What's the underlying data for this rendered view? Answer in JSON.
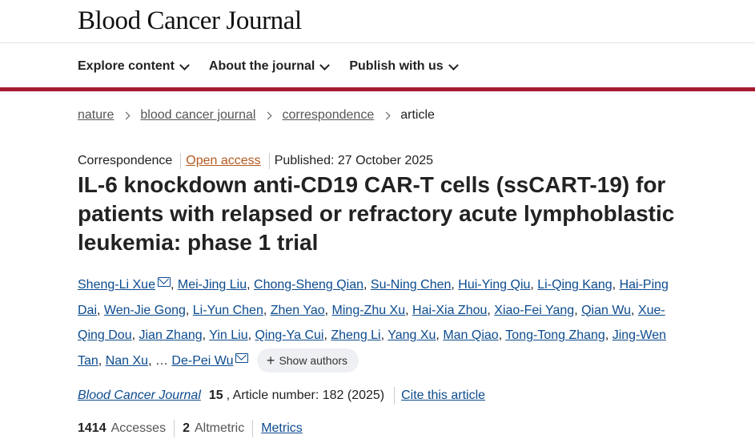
{
  "journal": {
    "title": "Blood Cancer Journal"
  },
  "nav": [
    {
      "label": "Explore content"
    },
    {
      "label": "About the journal"
    },
    {
      "label": "Publish with us"
    }
  ],
  "breadcrumb": {
    "items": [
      "nature",
      "blood cancer journal",
      "correspondence"
    ],
    "current": "article"
  },
  "article": {
    "type": "Correspondence",
    "access": "Open access",
    "published": "Published: 27 October 2025",
    "title": "IL-6 knockdown anti-CD19 CAR-T cells (ssCART-19) for patients with relapsed or refractory acute lymphoblastic leukemia: phase 1 trial",
    "authors": [
      "Sheng-Li Xue",
      "Mei-Jing Liu",
      "Chong-Sheng Qian",
      "Su-Ning Chen",
      "Hui-Ying Qiu",
      "Li-Qing Kang",
      "Hai-Ping Dai",
      "Wen-Jie Gong",
      "Li-Yun Chen",
      "Zhen Yao",
      "Ming-Zhu Xu",
      "Hai-Xia Zhou",
      "Xiao-Fei Yang",
      "Qian Wu",
      "Xue-Qing Dou",
      "Jian Zhang",
      "Yin Liu",
      "Qing-Ya Cui",
      "Zheng Li",
      "Yang Xu",
      "Man Qiao",
      "Tong-Tong Zhang",
      "Jing-Wen Tan",
      "Nan Xu"
    ],
    "ellipsis": "…",
    "last_author": "De-Pei Wu",
    "show_authors": "Show authors"
  },
  "citation": {
    "journal": "Blood Cancer Journal",
    "volume": "15",
    "rest": ", Article number: 182 (2025)",
    "cite_label": "Cite this article"
  },
  "metrics": {
    "accesses_count": "1414",
    "accesses_label": "Accesses",
    "altmetric_count": "2",
    "altmetric_label": "Altmetric",
    "metrics_link": "Metrics"
  },
  "colors": {
    "accent_bar": "#a51c30",
    "link": "#0c4b8e",
    "open_access": "#b55a1f"
  }
}
